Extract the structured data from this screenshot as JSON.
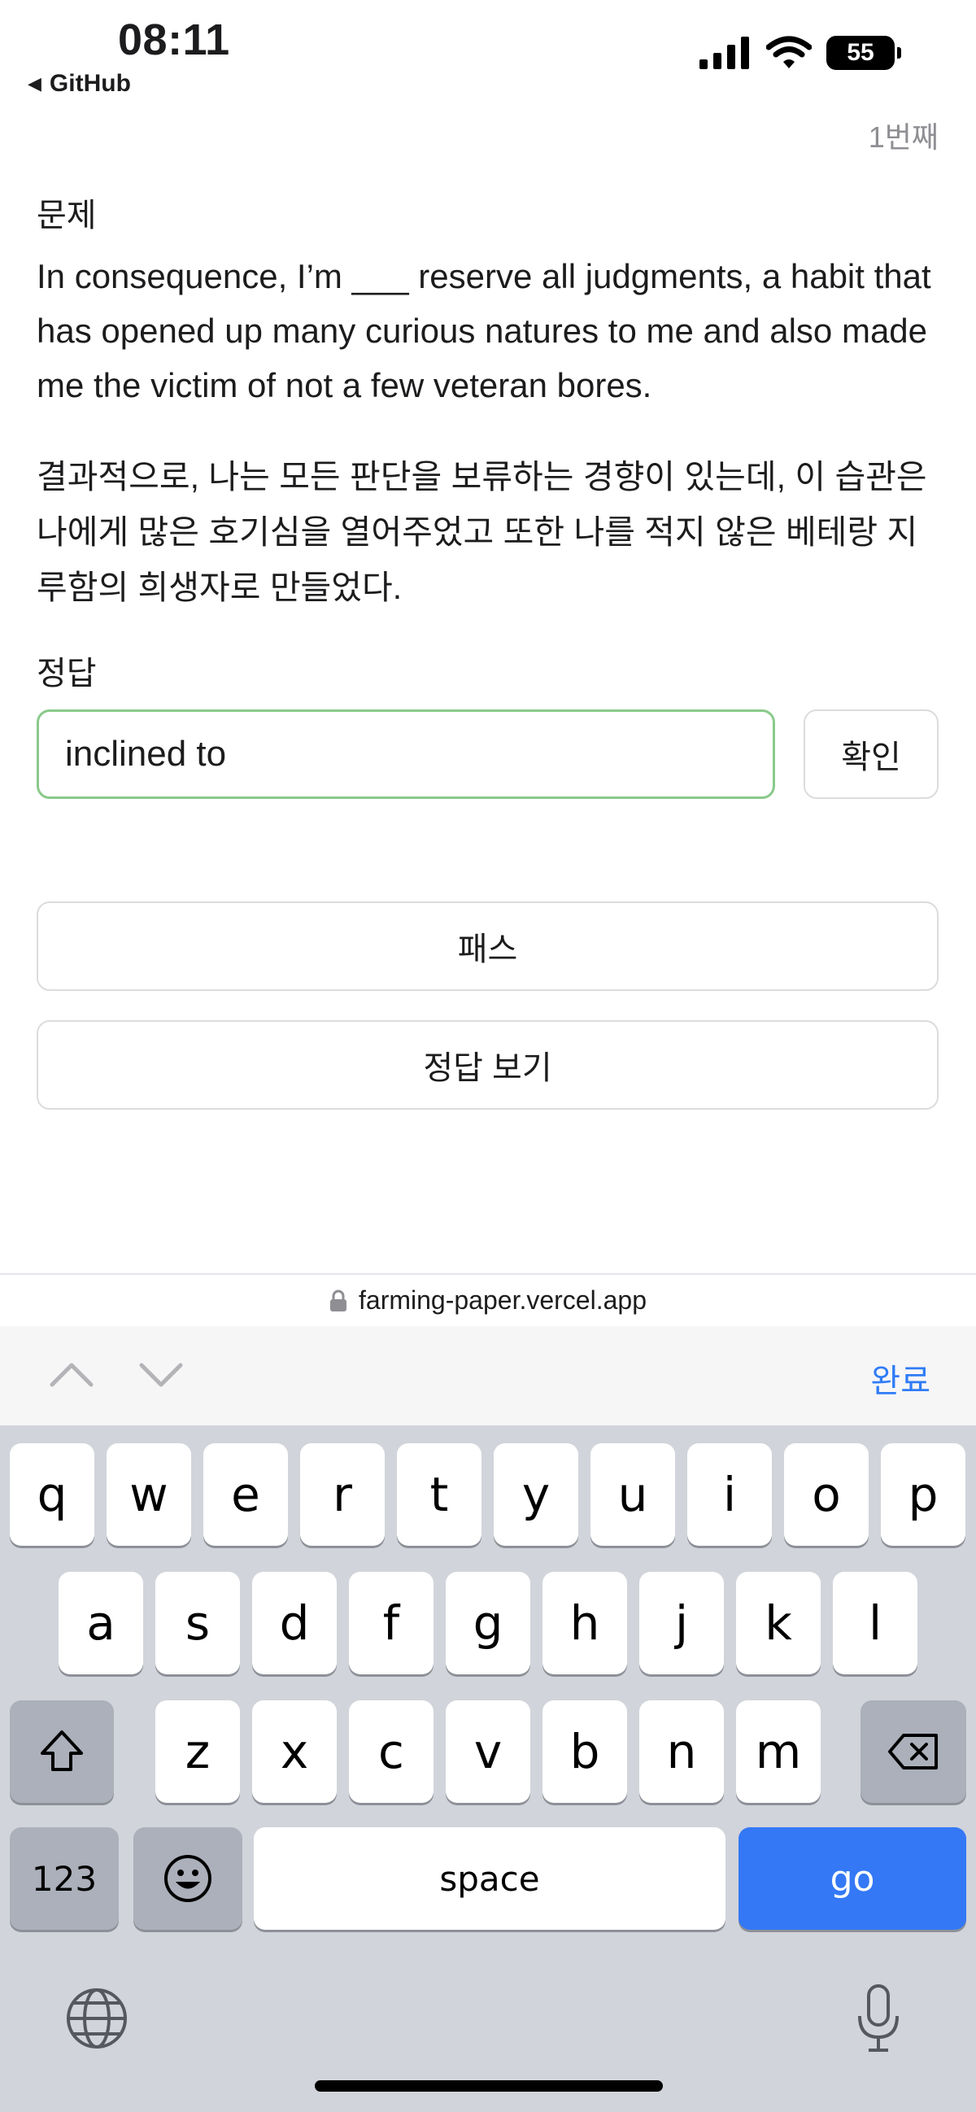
{
  "status_bar": {
    "time": "08:11",
    "back_app": "GitHub",
    "battery": "55"
  },
  "quiz": {
    "counter": "1번째",
    "question_label": "문제",
    "question_en": "In consequence, I’m ___ reserve all judgments, a habit that has opened up many curious natures to me and also made me the victim of not a few veteran bores.",
    "question_ko": "결과적으로, 나는 모든 판단을 보류하는 경향이 있는데, 이 습관은 나에게 많은 호기심을 열어주었고 또한 나를 적지 않은 베테랑 지루함의 희생자로 만들었다.",
    "answer_label": "정답",
    "answer_value": "inclined to",
    "confirm_label": "확인",
    "pass_label": "패스",
    "show_answer_label": "정답 보기"
  },
  "browser": {
    "url": "farming-paper.vercel.app"
  },
  "keyboard": {
    "done_label": "완료",
    "row1": [
      "q",
      "w",
      "e",
      "r",
      "t",
      "y",
      "u",
      "i",
      "o",
      "p"
    ],
    "row2": [
      "a",
      "s",
      "d",
      "f",
      "g",
      "h",
      "j",
      "k",
      "l"
    ],
    "row3": [
      "z",
      "x",
      "c",
      "v",
      "b",
      "n",
      "m"
    ],
    "numbers_label": "123",
    "space_label": "space",
    "go_label": "go"
  }
}
